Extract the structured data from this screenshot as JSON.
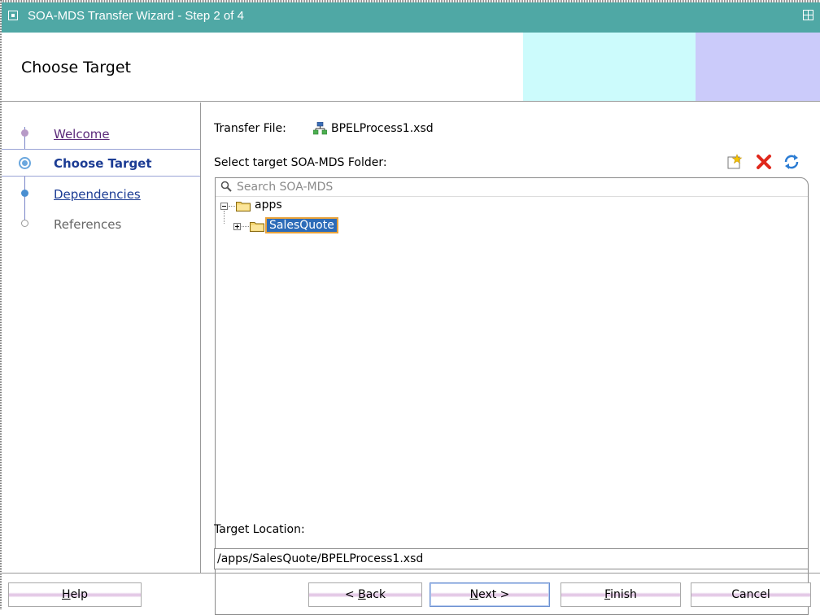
{
  "window": {
    "title": "SOA-MDS Transfer Wizard - Step 2 of 4"
  },
  "header": {
    "title": "Choose Target",
    "band_colors": [
      "#ccfbfc",
      "#cbcbfa"
    ]
  },
  "train": {
    "steps": [
      {
        "label": "Welcome",
        "state": "visited"
      },
      {
        "label": "Choose Target",
        "state": "current"
      },
      {
        "label": "Dependencies",
        "state": "next"
      },
      {
        "label": "References",
        "state": "disabled"
      }
    ]
  },
  "content": {
    "transfer_file_label": "Transfer File:",
    "transfer_file_name": "BPELProcess1.xsd",
    "transfer_file_icon": "schema-icon",
    "folder_label": "Select target SOA-MDS Folder:",
    "toolbar_icons": [
      "new-folder-icon",
      "delete-icon",
      "refresh-icon"
    ],
    "search": {
      "placeholder": "Search SOA-MDS",
      "value": ""
    },
    "tree": [
      {
        "label": "apps",
        "expanded": true,
        "level": 0
      },
      {
        "label": "SalesQuote",
        "expanded": false,
        "level": 1,
        "selected": true
      }
    ],
    "target_location_label": "Target Location:",
    "target_location_value": "/apps/SalesQuote/BPELProcess1.xsd"
  },
  "buttons": {
    "help": {
      "pre": "",
      "mn": "H",
      "post": "elp"
    },
    "back": {
      "pre": "< ",
      "mn": "B",
      "post": "ack"
    },
    "next": {
      "pre": "",
      "mn": "N",
      "post": "ext >"
    },
    "finish": {
      "pre": "",
      "mn": "F",
      "post": "inish"
    },
    "cancel": {
      "pre": "Cancel",
      "mn": "",
      "post": ""
    }
  },
  "colors": {
    "titlebar": "#4fa8a5",
    "selection": "#2c6bb8",
    "selection_border": "#e8a23b",
    "link_visited": "#5b2a7a",
    "link": "#1c3c94"
  }
}
